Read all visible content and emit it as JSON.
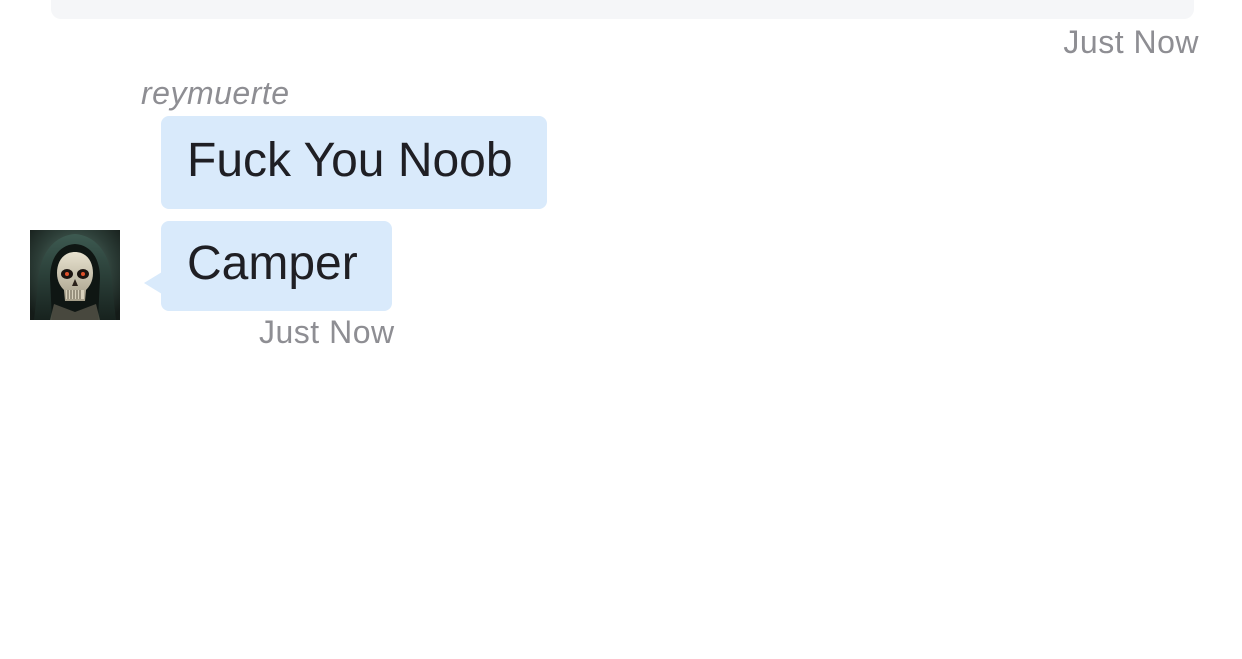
{
  "previous_message": {
    "timestamp": "Just Now"
  },
  "incoming": {
    "sender": "reymuerte",
    "messages": [
      {
        "text": "Fuck You Noob"
      },
      {
        "text": "Camper"
      }
    ],
    "timestamp": "Just Now",
    "avatar_icon": "hooded-skull-avatar"
  },
  "colors": {
    "bubble_incoming": "#d9eafb",
    "bubble_previous": "#f5f6f8",
    "meta_text": "#8e8e93",
    "message_text": "#1f1f24"
  }
}
